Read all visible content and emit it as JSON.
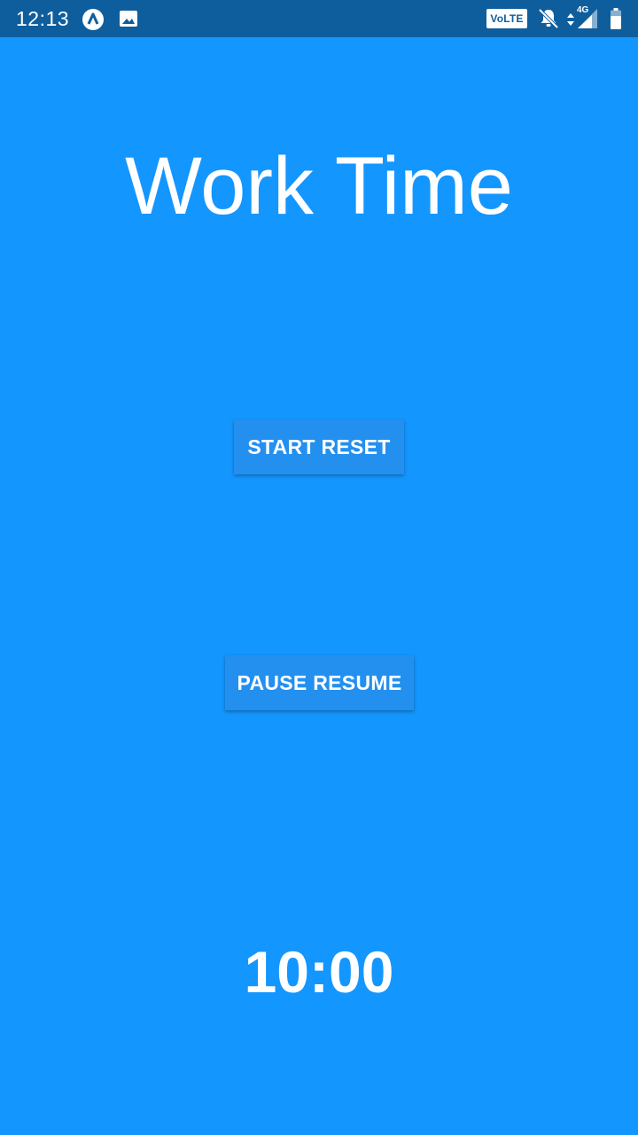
{
  "status_bar": {
    "time": "12:13",
    "left_icons": [
      "app-notification-icon",
      "image-icon"
    ],
    "volte_label": "VoLTE",
    "network_label": "4G",
    "right_icons": [
      "volte-icon",
      "notifications-off-icon",
      "signal-icon",
      "battery-icon"
    ]
  },
  "screen": {
    "title": "Work Time",
    "start_reset_label": "START RESET",
    "pause_resume_label": "PAUSE RESUME",
    "timer": "10:00"
  },
  "colors": {
    "background": "#1496FF",
    "status_bar": "#0E5E9E",
    "button": "#2390F0",
    "text": "#FFFFFF"
  }
}
